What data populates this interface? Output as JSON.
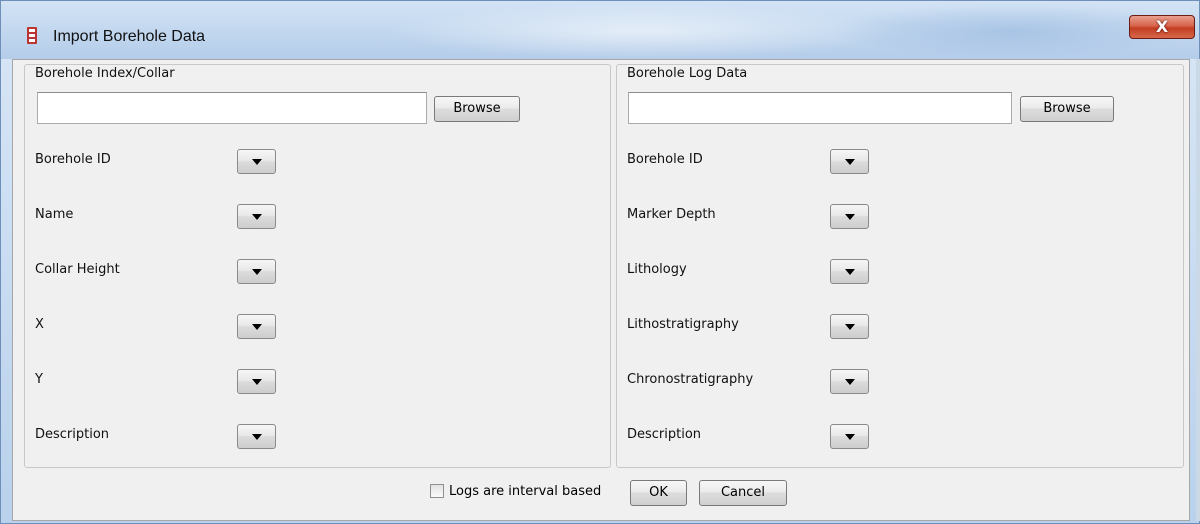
{
  "window": {
    "title": "Import Borehole Data",
    "close_label": "X"
  },
  "collar_panel": {
    "title": "Borehole Index/Collar",
    "file_value": "",
    "browse_label": "Browse",
    "fields": [
      {
        "label": "Borehole ID",
        "selected": ""
      },
      {
        "label": "Name",
        "selected": ""
      },
      {
        "label": "Collar Height",
        "selected": ""
      },
      {
        "label": "X",
        "selected": ""
      },
      {
        "label": "Y",
        "selected": ""
      },
      {
        "label": "Description",
        "selected": ""
      }
    ]
  },
  "log_panel": {
    "title": "Borehole Log Data",
    "file_value": "",
    "browse_label": "Browse",
    "fields": [
      {
        "label": "Borehole ID",
        "selected": ""
      },
      {
        "label": "Marker Depth",
        "selected": ""
      },
      {
        "label": "Lithology",
        "selected": ""
      },
      {
        "label": "Lithostratigraphy",
        "selected": ""
      },
      {
        "label": "Chronostratigraphy",
        "selected": ""
      },
      {
        "label": "Description",
        "selected": ""
      }
    ]
  },
  "footer": {
    "interval_label": "Logs are interval based",
    "interval_checked": false,
    "ok_label": "OK",
    "cancel_label": "Cancel"
  }
}
